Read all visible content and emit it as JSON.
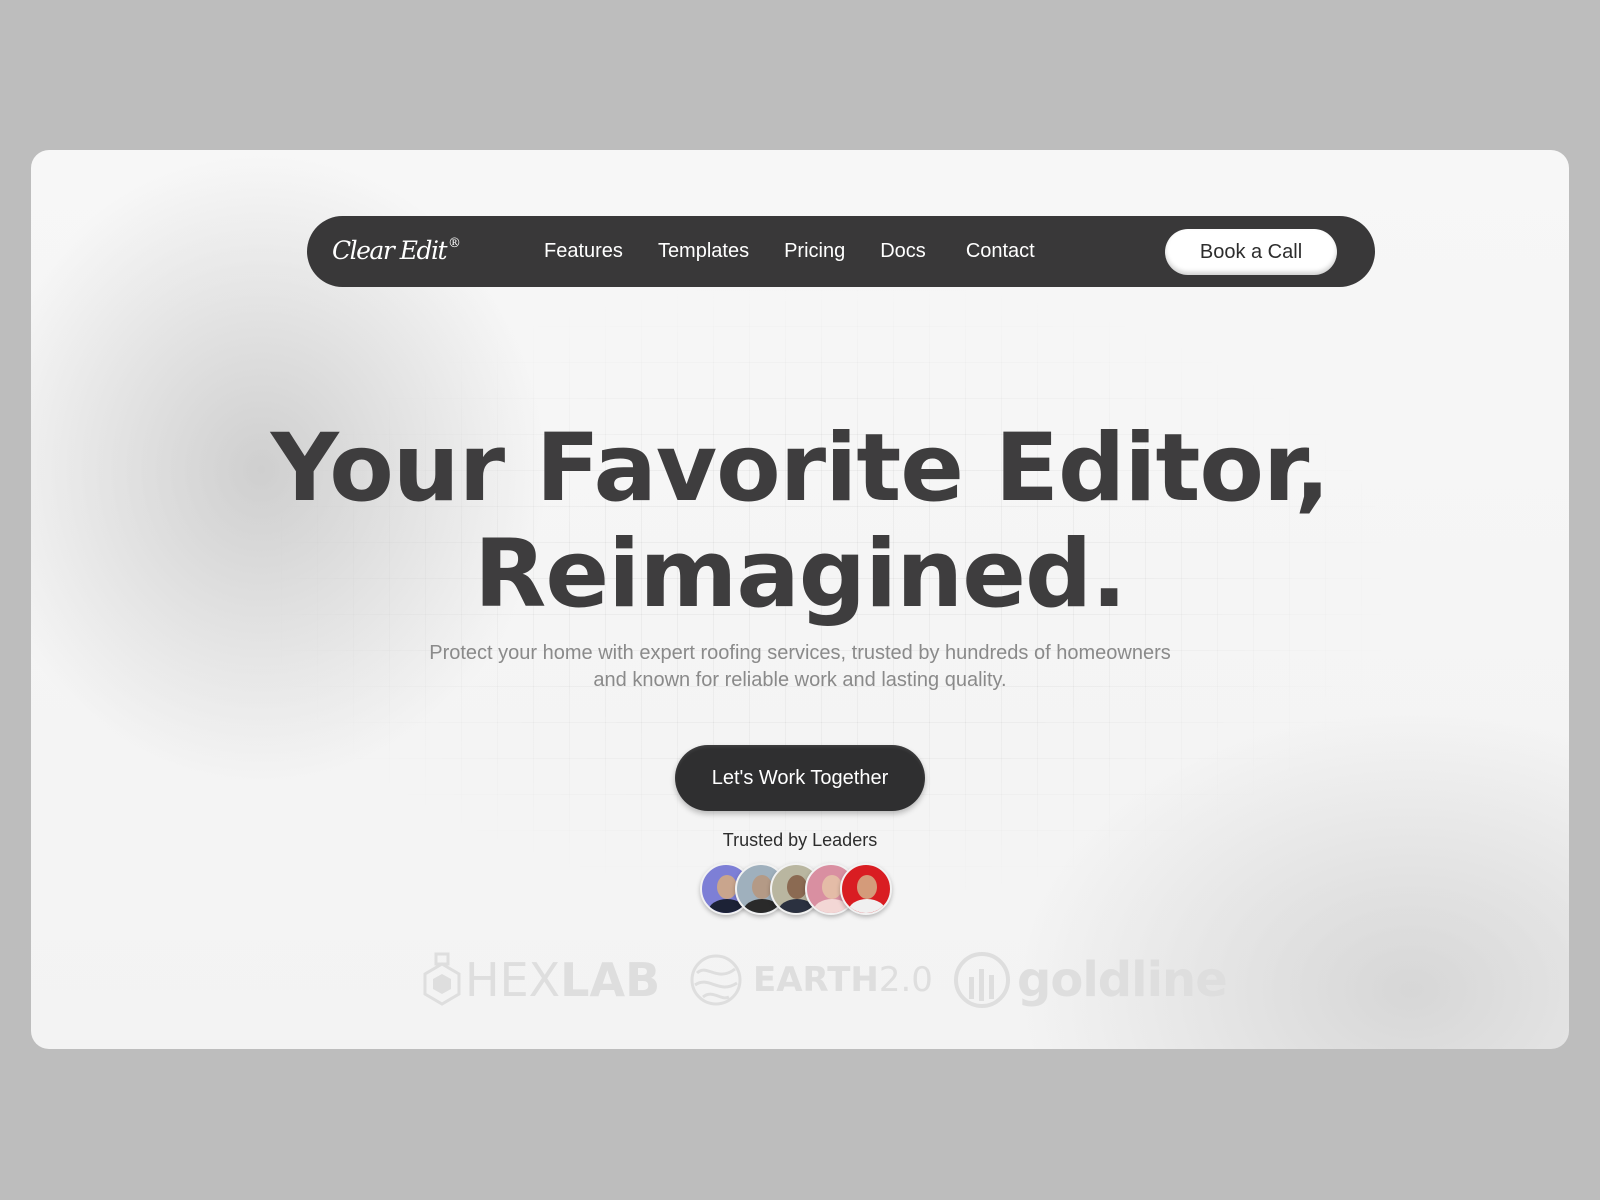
{
  "nav": {
    "logo": "Clear Edit",
    "logo_mark": "®",
    "links": [
      "Features",
      "Templates",
      "Pricing",
      "Docs",
      "Contact"
    ],
    "cta": "Book a Call"
  },
  "hero": {
    "line1": "Your Favorite Editor,",
    "line2": "Reimagined.",
    "subtitle_1": "Protect your home with expert roofing services, trusted by hundreds of homeowners",
    "subtitle_2": "and known for reliable work and lasting quality.",
    "cta": "Let's Work Together",
    "trusted": "Trusted by Leaders"
  },
  "avatars": [
    {
      "icon": "avatar-person-1",
      "bg": "#7d7fd6"
    },
    {
      "icon": "avatar-person-2",
      "bg": "#9fb0bd"
    },
    {
      "icon": "avatar-person-3",
      "bg": "#b9b6a0"
    },
    {
      "icon": "avatar-person-4",
      "bg": "#d98fa1"
    },
    {
      "icon": "avatar-person-5",
      "bg": "#d91d22"
    }
  ],
  "partners": {
    "hexlab_1": "HEX",
    "hexlab_2": "LAB",
    "earth_1": "EARTH",
    "earth_2": "2.0",
    "goldline": "goldline"
  },
  "colors": {
    "background": "#bdbdbd",
    "navbar": "#393839",
    "headline": "#3e3d3e",
    "partner_logos": "#dedede"
  }
}
